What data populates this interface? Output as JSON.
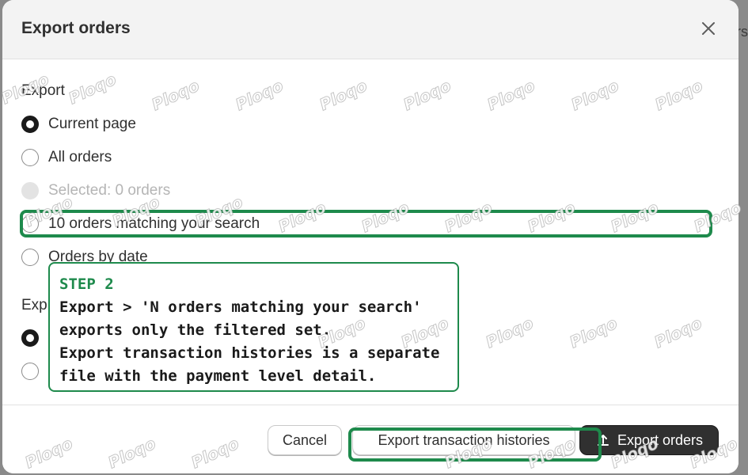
{
  "dialog": {
    "title": "Export orders",
    "close_icon": "close-icon"
  },
  "export_section": {
    "label": "Export",
    "options": [
      {
        "label": "Current page",
        "state": "checked"
      },
      {
        "label": "All orders",
        "state": "unchecked"
      },
      {
        "label": "Selected: 0 orders",
        "state": "disabled"
      },
      {
        "label": "10 orders matching your search",
        "state": "unchecked"
      },
      {
        "label": "Orders by date",
        "state": "unchecked"
      }
    ]
  },
  "export_as_section": {
    "label_visible": "Exp"
  },
  "footer": {
    "cancel_label": "Cancel",
    "transaction_label": "Export transaction histories",
    "export_label": "Export orders",
    "export_icon": "upload-icon"
  },
  "tutorial": {
    "step_label": "STEP 2",
    "lines": [
      "Export > 'N orders matching your search'",
      "exports only the filtered set.",
      "Export transaction histories is a separate",
      "file with the payment level detail."
    ],
    "accent_color": "#1e8a4c"
  },
  "watermark": {
    "text": "Ploqo"
  },
  "backdrop": {
    "peek_text": "rs"
  },
  "colors": {
    "primary_button": "#303030",
    "header_bg": "#f3f3f3"
  }
}
